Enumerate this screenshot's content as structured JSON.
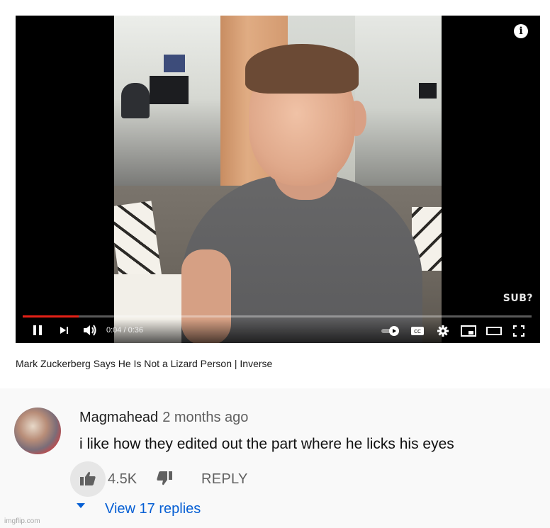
{
  "video": {
    "title": "Mark Zuckerberg Says He Is Not a Lizard Person | Inverse",
    "overlay_text": "SUB?",
    "time_display": "0:04 / 0:36",
    "progress_fraction": 0.11,
    "icons": {
      "info": "info-icon",
      "pause": "pause-icon",
      "next": "next-icon",
      "volume": "volume-icon",
      "autoplay": "autoplay-toggle-icon",
      "captions": "captions-icon",
      "settings": "gear-icon",
      "miniplayer": "miniplayer-icon",
      "theater": "theater-icon",
      "fullscreen": "fullscreen-icon"
    },
    "progress_color": "#e52117"
  },
  "comment": {
    "author": "Magmahead",
    "timestamp": "2 months ago",
    "text": "i like how they edited out the part where he licks his eyes",
    "likes": "4.5K",
    "reply_label": "REPLY",
    "view_replies": "View 17 replies",
    "accent_color": "#065fd4"
  },
  "watermark": "imgflip.com"
}
